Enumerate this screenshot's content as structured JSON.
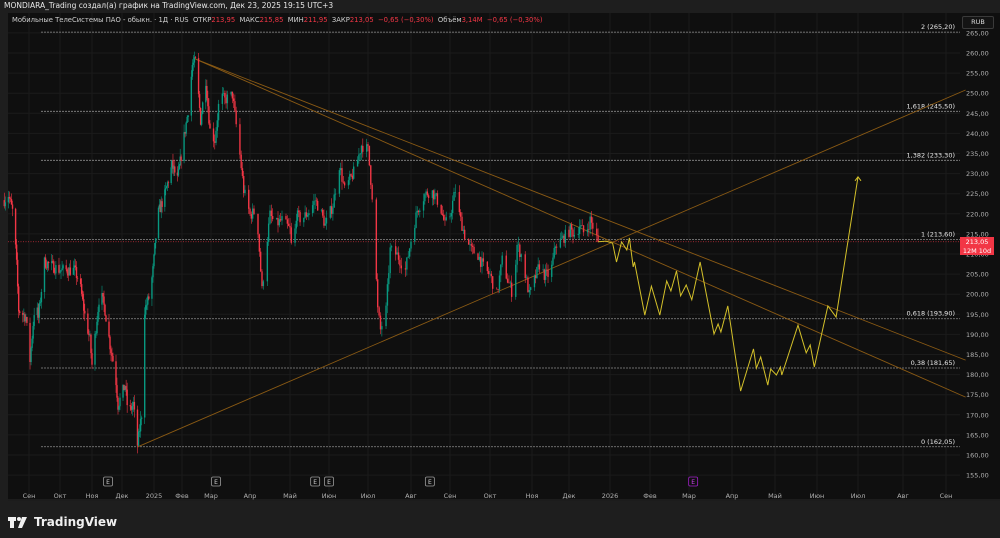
{
  "header": {
    "attribution": "MONDIARA_Trading создал(а) график на TradingView.com, Дек 23, 2025 19:15 UTC+3"
  },
  "legend": {
    "symbol": "Мобильные ТелеСистемы ПАО - обыкн. · 1Д · RUS",
    "open_label": "ОТКР",
    "open": "213,95",
    "high_label": "МАКС",
    "high": "215,85",
    "low_label": "МИН",
    "low": "211,95",
    "close_label": "ЗАКР",
    "close": "213,05",
    "change": "−0,65 (−0,30%)",
    "volume_label": "Объём",
    "volume": "3,14M",
    "volume_change": "−0,65 (−0,30%)"
  },
  "currency_button": "RUB",
  "last_price_badge": {
    "price": "213,05",
    "countdown": "12M 10d"
  },
  "brand": {
    "name": "TradingView"
  },
  "colors": {
    "background": "#0f0f0f",
    "up": "#089981",
    "down": "#f23645",
    "projection": "#d4c12a",
    "trendline": "#8a5a14",
    "fib": "#8c8c8c",
    "last_price": "#f23645",
    "earnings_future": "#a020c8"
  },
  "chart_data": {
    "type": "candlestick",
    "title": "",
    "ylim": [
      152,
      268
    ],
    "grid": true,
    "y_ticks": [
      "155,00",
      "160,00",
      "165,00",
      "170,00",
      "175,00",
      "180,00",
      "185,00",
      "190,00",
      "195,00",
      "200,00",
      "205,00",
      "210,00",
      "215,00",
      "220,00",
      "225,00",
      "230,00",
      "235,00",
      "240,00",
      "245,00",
      "250,00",
      "255,00",
      "260,00",
      "265,00"
    ],
    "x_ticks": [
      {
        "label": "Сен",
        "date": "2024-09-01"
      },
      {
        "label": "Окт",
        "date": "2024-10-01"
      },
      {
        "label": "Ноя",
        "date": "2024-11-01"
      },
      {
        "label": "Дек",
        "date": "2024-12-01"
      },
      {
        "label": "2025",
        "date": "2025-01-01"
      },
      {
        "label": "Фев",
        "date": "2025-02-01"
      },
      {
        "label": "Мар",
        "date": "2025-03-01"
      },
      {
        "label": "Апр",
        "date": "2025-04-01"
      },
      {
        "label": "Май",
        "date": "2025-05-01"
      },
      {
        "label": "Июн",
        "date": "2025-06-01"
      },
      {
        "label": "Июл",
        "date": "2025-07-01"
      },
      {
        "label": "Авг",
        "date": "2025-08-01"
      },
      {
        "label": "Сен",
        "date": "2025-09-01"
      },
      {
        "label": "Окт",
        "date": "2025-10-01"
      },
      {
        "label": "Ноя",
        "date": "2025-11-01"
      },
      {
        "label": "Дек",
        "date": "2025-12-01"
      },
      {
        "label": "2026",
        "date": "2026-01-01"
      },
      {
        "label": "Фев",
        "date": "2026-02-01"
      },
      {
        "label": "Мар",
        "date": "2026-03-01"
      },
      {
        "label": "Апр",
        "date": "2026-04-01"
      },
      {
        "label": "Май",
        "date": "2026-05-01"
      },
      {
        "label": "Июн",
        "date": "2026-06-01"
      },
      {
        "label": "Июл",
        "date": "2026-07-01"
      },
      {
        "label": "Авг",
        "date": "2026-08-01"
      },
      {
        "label": "Сен",
        "date": "2026-09-01"
      }
    ],
    "price_path": [
      [
        "2024-08-08",
        223.4
      ],
      [
        "2024-08-12",
        224.7
      ],
      [
        "2024-08-17",
        219.7
      ],
      [
        "2024-08-20",
        207.3
      ],
      [
        "2024-08-22",
        196.1
      ],
      [
        "2024-08-29",
        194.3
      ],
      [
        "2024-09-02",
        183.6
      ],
      [
        "2024-09-07",
        198.6
      ],
      [
        "2024-09-10",
        194.1
      ],
      [
        "2024-09-16",
        208.0
      ],
      [
        "2024-10-01",
        206.0
      ],
      [
        "2024-10-15",
        206.0
      ],
      [
        "2024-10-20",
        203.0
      ],
      [
        "2024-10-25",
        194.8
      ],
      [
        "2024-10-30",
        188.6
      ],
      [
        "2024-11-01",
        182.4
      ],
      [
        "2024-11-09",
        201.0
      ],
      [
        "2024-11-14",
        196.1
      ],
      [
        "2024-11-19",
        187.4
      ],
      [
        "2024-11-24",
        181.1
      ],
      [
        "2024-11-27",
        172.4
      ],
      [
        "2024-12-04",
        177.4
      ],
      [
        "2024-12-07",
        170.2
      ],
      [
        "2024-12-12",
        172.7
      ],
      [
        "2024-12-16",
        162.5
      ],
      [
        "2024-12-20",
        170.2
      ],
      [
        "2024-12-23",
        196.1
      ],
      [
        "2024-12-28",
        199.8
      ],
      [
        "2024-12-31",
        206.0
      ],
      [
        "2025-01-05",
        219.7
      ],
      [
        "2025-01-13",
        224.7
      ],
      [
        "2025-01-21",
        232.1
      ],
      [
        "2025-01-27",
        228.4
      ],
      [
        "2025-02-01",
        235.9
      ],
      [
        "2025-02-07",
        245.8
      ],
      [
        "2025-02-11",
        257.0
      ],
      [
        "2025-02-14",
        257.8
      ],
      [
        "2025-02-19",
        243.3
      ],
      [
        "2025-02-24",
        253.3
      ],
      [
        "2025-02-28",
        240.8
      ],
      [
        "2025-03-04",
        238.4
      ],
      [
        "2025-03-08",
        249.6
      ],
      [
        "2025-03-12",
        248.3
      ],
      [
        "2025-03-18",
        249.6
      ],
      [
        "2025-03-24",
        234.6
      ],
      [
        "2025-03-27",
        225.9
      ],
      [
        "2025-04-01",
        219.7
      ],
      [
        "2025-04-06",
        220.9
      ],
      [
        "2025-04-10",
        201.0
      ],
      [
        "2025-04-13",
        211.0
      ],
      [
        "2025-04-16",
        219.7
      ],
      [
        "2025-04-20",
        217.2
      ],
      [
        "2025-04-25",
        218.5
      ],
      [
        "2025-05-01",
        216.0
      ],
      [
        "2025-05-03",
        208.5
      ],
      [
        "2025-05-06",
        219.7
      ],
      [
        "2025-05-10",
        218.5
      ],
      [
        "2025-05-17",
        220.9
      ],
      [
        "2025-05-21",
        223.4
      ],
      [
        "2025-05-25",
        220.9
      ],
      [
        "2025-05-29",
        217.2
      ],
      [
        "2025-06-04",
        222.2
      ],
      [
        "2025-06-09",
        232.1
      ],
      [
        "2025-06-13",
        225.9
      ],
      [
        "2025-06-21",
        230.9
      ],
      [
        "2025-06-26",
        237.1
      ],
      [
        "2025-07-01",
        235.9
      ],
      [
        "2025-07-04",
        224.7
      ],
      [
        "2025-07-08",
        196.1
      ],
      [
        "2025-07-10",
        191.1
      ],
      [
        "2025-07-14",
        196.1
      ],
      [
        "2025-07-17",
        211.0
      ],
      [
        "2025-07-22",
        209.8
      ],
      [
        "2025-07-28",
        206.0
      ],
      [
        "2025-08-01",
        213.5
      ],
      [
        "2025-08-06",
        220.9
      ],
      [
        "2025-08-12",
        224.7
      ],
      [
        "2025-08-17",
        225.9
      ],
      [
        "2025-08-24",
        222.2
      ],
      [
        "2025-08-28",
        217.2
      ],
      [
        "2025-09-01",
        219.7
      ],
      [
        "2025-09-05",
        225.9
      ],
      [
        "2025-09-08",
        219.7
      ],
      [
        "2025-09-13",
        213.5
      ],
      [
        "2025-09-17",
        211.0
      ],
      [
        "2025-09-22",
        209.8
      ],
      [
        "2025-09-27",
        206.0
      ],
      [
        "2025-10-01",
        204.8
      ],
      [
        "2025-10-06",
        199.8
      ],
      [
        "2025-10-10",
        208.5
      ],
      [
        "2025-10-14",
        203.5
      ],
      [
        "2025-10-18",
        199.8
      ],
      [
        "2025-10-21",
        212.2
      ],
      [
        "2025-10-24",
        209.8
      ],
      [
        "2025-10-30",
        199.8
      ],
      [
        "2025-11-03",
        203.5
      ],
      [
        "2025-11-07",
        207.3
      ],
      [
        "2025-11-11",
        204.8
      ],
      [
        "2025-11-16",
        204.8
      ],
      [
        "2025-11-20",
        212.2
      ],
      [
        "2025-11-25",
        213.5
      ],
      [
        "2025-12-02",
        216.0
      ],
      [
        "2025-12-06",
        214.7
      ],
      [
        "2025-12-09",
        217.2
      ],
      [
        "2025-12-13",
        214.7
      ],
      [
        "2025-12-17",
        218.5
      ],
      [
        "2025-12-20",
        216.0
      ],
      [
        "2025-12-23",
        213.05
      ]
    ],
    "projection_path": [
      [
        "2025-12-23",
        213.05
      ],
      [
        "2025-12-29",
        213.2
      ],
      [
        "2026-01-03",
        212.7
      ],
      [
        "2026-01-06",
        208.0
      ],
      [
        "2026-01-10",
        213.0
      ],
      [
        "2026-01-14",
        211.0
      ],
      [
        "2026-01-16",
        214.0
      ],
      [
        "2026-01-19",
        206.8
      ],
      [
        "2026-01-20",
        208.0
      ],
      [
        "2026-01-28",
        194.8
      ],
      [
        "2026-02-02",
        202.0
      ],
      [
        "2026-02-08",
        194.8
      ],
      [
        "2026-02-13",
        203.3
      ],
      [
        "2026-02-16",
        200.8
      ],
      [
        "2026-02-20",
        205.8
      ],
      [
        "2026-02-23",
        199.6
      ],
      [
        "2026-02-27",
        202.3
      ],
      [
        "2026-03-03",
        198.6
      ],
      [
        "2026-03-09",
        208.0
      ],
      [
        "2026-03-19",
        190.1
      ],
      [
        "2026-03-22",
        192.6
      ],
      [
        "2026-03-24",
        190.6
      ],
      [
        "2026-03-29",
        197.1
      ],
      [
        "2026-04-07",
        175.9
      ],
      [
        "2026-04-16",
        186.4
      ],
      [
        "2026-04-18",
        181.6
      ],
      [
        "2026-04-21",
        184.4
      ],
      [
        "2026-04-26",
        177.4
      ],
      [
        "2026-04-28",
        181.4
      ],
      [
        "2026-05-02",
        179.9
      ],
      [
        "2026-05-05",
        181.9
      ],
      [
        "2026-05-06",
        179.9
      ],
      [
        "2026-05-18",
        192.3
      ],
      [
        "2026-05-24",
        185.4
      ],
      [
        "2026-05-27",
        187.4
      ],
      [
        "2026-05-30",
        181.9
      ],
      [
        "2026-06-09",
        197.1
      ],
      [
        "2026-06-15",
        194.3
      ],
      [
        "2026-07-01",
        229.2
      ]
    ],
    "trendlines": [
      {
        "from": [
          "2025-02-14",
          258.5
        ],
        "to": [
          "2026-09-15",
          183.6
        ]
      },
      {
        "from": [
          "2025-02-14",
          258.5
        ],
        "to": [
          "2026-09-15",
          174.4
        ]
      },
      {
        "from": [
          "2024-12-16",
          162.0
        ],
        "to": [
          "2026-09-15",
          250.8
        ]
      }
    ],
    "fib_levels": [
      {
        "label": "2 (265,20)",
        "price": 265.2
      },
      {
        "label": "1,618 (245,50)",
        "price": 245.5
      },
      {
        "label": "1,382 (233,30)",
        "price": 233.3
      },
      {
        "label": "1 (213,60)",
        "price": 213.6
      },
      {
        "label": "0,618 (193,90)",
        "price": 193.9
      },
      {
        "label": "0,38 (181,65)",
        "price": 181.65
      },
      {
        "label": "0 (162,05)",
        "price": 162.05
      }
    ],
    "last_price": 213.05,
    "earnings_events": [
      {
        "label": "E",
        "date": "2024-11-17",
        "future": false
      },
      {
        "label": "E",
        "date": "2025-03-05",
        "future": false
      },
      {
        "label": "E",
        "date": "2025-05-21",
        "future": false
      },
      {
        "label": "E",
        "date": "2025-06-01",
        "future": false
      },
      {
        "label": "E",
        "date": "2025-08-16",
        "future": false
      },
      {
        "label": "E",
        "date": "2026-03-04",
        "future": true
      }
    ]
  }
}
